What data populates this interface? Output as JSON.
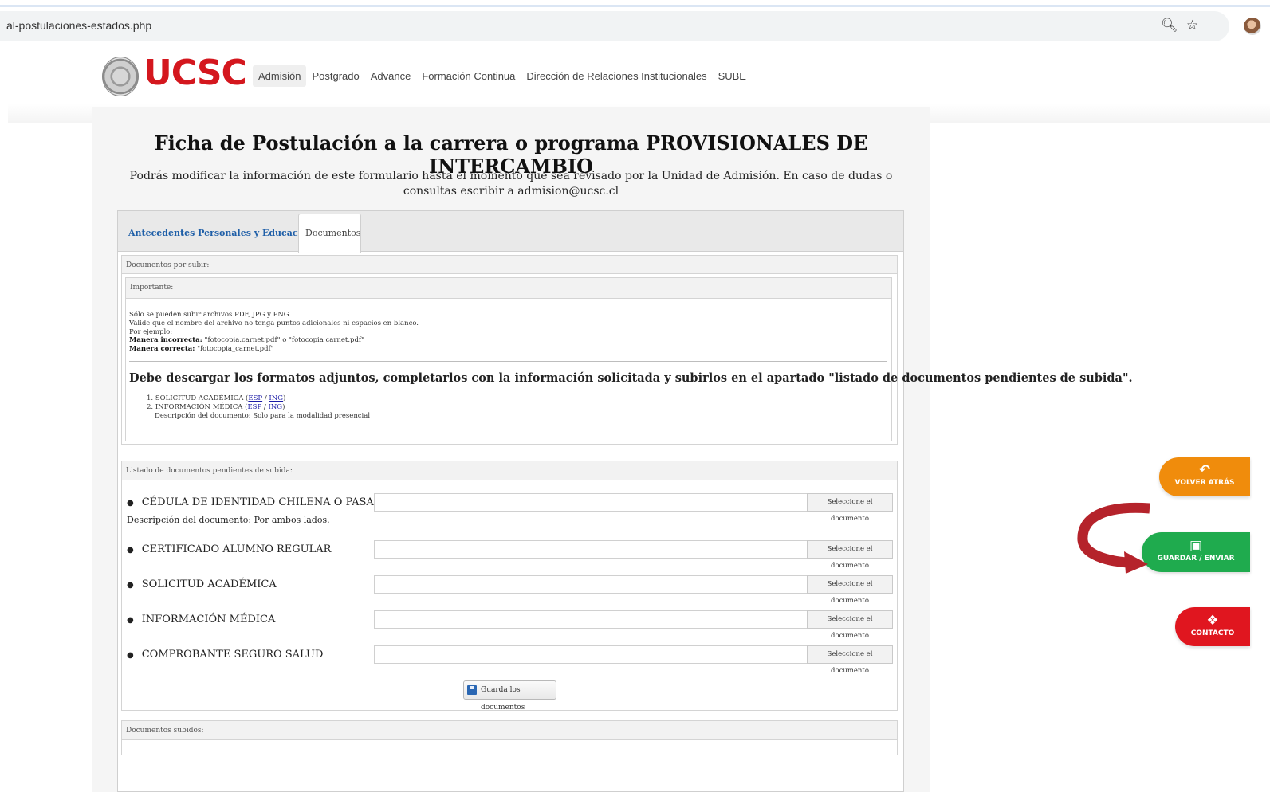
{
  "browser": {
    "url": "al-postulaciones-estados.php",
    "icons": [
      "zoom-icon",
      "star-icon",
      "avatar"
    ]
  },
  "site": {
    "logo_text": "UCSC",
    "nav": [
      "Admisión",
      "Postgrado",
      "Advance",
      "Formación Continua",
      "Dirección de Relaciones Institucionales",
      "SUBE"
    ]
  },
  "page": {
    "title": "Ficha de Postulación a la carrera o programa PROVISIONALES DE INTERCAMBIO",
    "intro": "Podrás modificar la información de este formulario hasta el momento que sea revisado por la Unidad de Admisión. En caso de dudas o consultas escribir a admision@ucsc.cl"
  },
  "tabs": [
    {
      "label": "Antecedentes Personales y Educacionales"
    },
    {
      "label": "Documentos"
    }
  ],
  "docs_to_upload": {
    "heading": "Documentos por subir:",
    "important": {
      "heading": "Importante:",
      "lines": [
        "Sólo se pueden subir archivos PDF, JPG y PNG.",
        "Valide que el nombre del archivo no tenga puntos adicionales ni espacios en blanco.",
        "Por ejemplo:"
      ],
      "wrong_label": "Manera incorrecta:",
      "wrong_value": " \"fotocopia.carnet.pdf\" o \"fotocopia carnet.pdf\"",
      "right_label": "Manera correcta:",
      "right_value": " \"fotocopia_carnet.pdf\""
    },
    "instruction": "Debe descargar los formatos adjuntos, completarlos con la información solicitada y subirlos en el apartado \"listado de documentos pendientes de subida\".",
    "downloads": [
      {
        "num": "1.",
        "name": "SOLICITUD ACADÉMICA",
        "esp": "ESP",
        "ing": "ING"
      },
      {
        "num": "2.",
        "name": "INFORMACIÓN MÉDICA",
        "esp": "ESP",
        "ing": "ING"
      }
    ],
    "download_desc": "Descripción del documento: Solo para la modalidad presencial"
  },
  "pending": {
    "heading": "Listado de documentos pendientes de subida:",
    "button_label": "Seleccione el documento",
    "items": [
      {
        "name": "CÉDULA DE IDENTIDAD CHILENA O PASAPORTE",
        "desc": "Descripción del documento: Por ambos lados."
      },
      {
        "name": "CERTIFICADO ALUMNO REGULAR"
      },
      {
        "name": "SOLICITUD ACADÉMICA"
      },
      {
        "name": "INFORMACIÓN MÉDICA"
      },
      {
        "name": "COMPROBANTE SEGURO SALUD"
      }
    ],
    "save_label": "Guarda los documentos"
  },
  "uploaded": {
    "heading": "Documentos subidos:"
  },
  "floating": {
    "back": "VOLVER ATRÁS",
    "save": "GUARDAR / ENVIAR",
    "contact": "CONTACTO"
  },
  "colors": {
    "brand_red": "#d4171e",
    "back_orange": "#f08c0c",
    "save_green": "#1fab4e",
    "contact_red": "#e0161f",
    "arrow_red": "#b5232b"
  }
}
